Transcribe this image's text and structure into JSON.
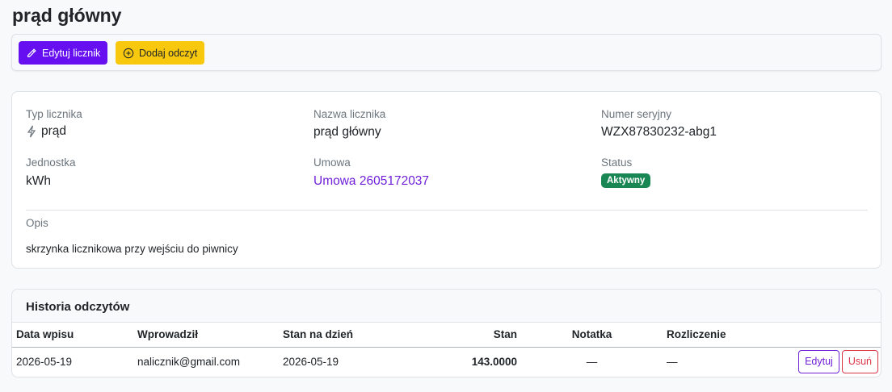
{
  "page": {
    "title": "prąd główny"
  },
  "toolbar": {
    "edit_label": "Edytuj licznik",
    "add_reading_label": "Dodaj odczyt",
    "colors": {
      "edit": "#6610f2",
      "add": "#f7c80d"
    }
  },
  "details": {
    "type_label": "Typ licznika",
    "type_value": "prąd",
    "type_icon": "lightning-icon",
    "name_label": "Nazwa licznika",
    "name_value": "prąd główny",
    "serial_label": "Numer seryjny",
    "serial_value": "WZX87830232-abg1",
    "unit_label": "Jednostka",
    "unit_value": "kWh",
    "contract_label": "Umowa",
    "contract_value": "Umowa 2605172037",
    "status_label": "Status",
    "status_value": "Aktywny",
    "status_color": "#198754",
    "description_label": "Opis",
    "description_value": "skrzynka licznikowa przy wejściu do piwnicy"
  },
  "history": {
    "title": "Historia odczytów",
    "columns": [
      "Data wpisu",
      "Wprowadził",
      "Stan na dzień",
      "Stan",
      "Notatka",
      "Rozliczenie"
    ],
    "rows": [
      {
        "entry_date": "2026-05-19",
        "entered_by": "nalicznik@gmail.com",
        "as_of_date": "2026-05-19",
        "reading": "143.0000",
        "note": "—",
        "settlement": "—",
        "edit_label": "Edytuj",
        "delete_label": "Usuń"
      }
    ]
  }
}
